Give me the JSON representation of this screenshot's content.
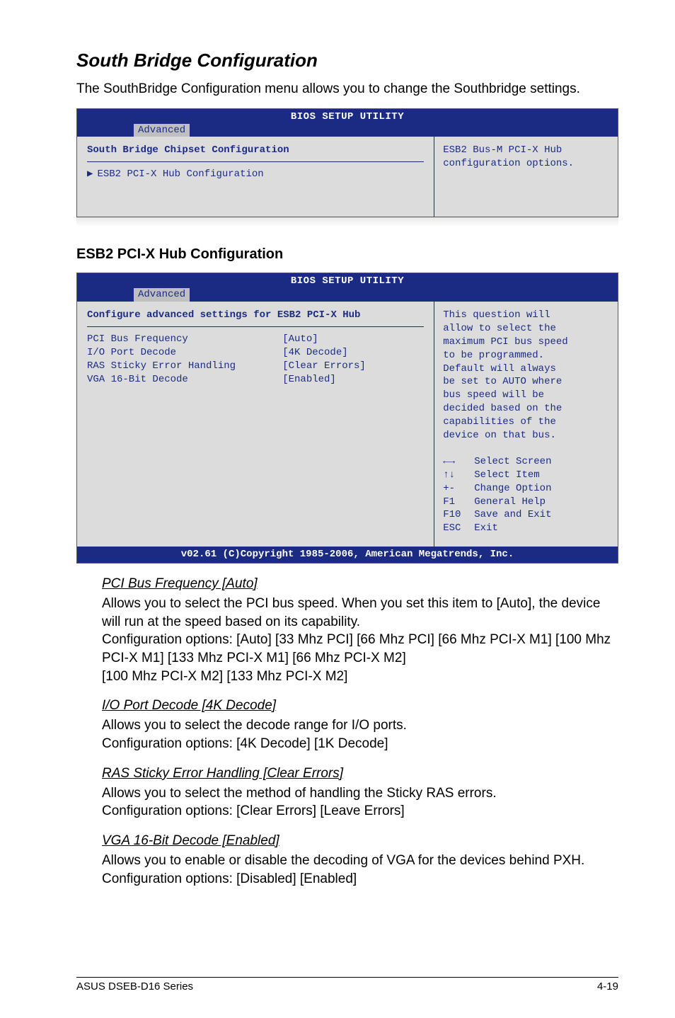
{
  "section_title": "South Bridge Configuration",
  "intro": "The SouthBridge Configuration menu allows you to change the Southbridge settings.",
  "bios1": {
    "header_title": "BIOS SETUP UTILITY",
    "tab": "Advanced",
    "left_heading": "South Bridge Chipset Configuration",
    "left_item": "ESB2 PCI-X Hub Configuration",
    "right_text1": "ESB2 Bus-M PCI-X Hub",
    "right_text2": "configuration options."
  },
  "sub_heading": "ESB2 PCI-X Hub Configuration",
  "bios2": {
    "header_title": "BIOS SETUP UTILITY",
    "tab": "Advanced",
    "left_heading": "Configure advanced settings for ESB2 PCI-X Hub",
    "rows": [
      {
        "label": "PCI Bus Frequency",
        "value": "[Auto]"
      },
      {
        "label": "I/O Port Decode",
        "value": "[4K Decode]"
      },
      {
        "label": "RAS Sticky Error Handling",
        "value": "[Clear Errors]"
      },
      {
        "label": "VGA 16-Bit Decode",
        "value": "[Enabled]"
      }
    ],
    "right_lines": [
      "This question will",
      "allow to select the",
      "maximum PCI bus speed",
      "to be programmed.",
      "Default will always",
      "be set to AUTO where",
      "bus speed will be",
      "decided based on the",
      "capabilities of the",
      "device on that bus."
    ],
    "help": [
      {
        "k": "←→",
        "t": "Select Screen"
      },
      {
        "k": "↑↓",
        "t": "Select Item"
      },
      {
        "k": "+-",
        "t": "Change Option"
      },
      {
        "k": "F1",
        "t": "General Help"
      },
      {
        "k": "F10",
        "t": "Save and Exit"
      },
      {
        "k": "ESC",
        "t": "Exit"
      }
    ],
    "footer": "v02.61 (C)Copyright 1985-2006, American Megatrends, Inc."
  },
  "items": [
    {
      "head": "PCI Bus Frequency [Auto]",
      "p1": "Allows you to select the PCI bus speed. When you set this item to [Auto], the device will run at the speed based on its capability.",
      "p2": "Configuration options: [Auto] [33 Mhz PCI] [66 Mhz PCI] [66 Mhz PCI-X M1] [100 Mhz PCI-X M1] [133 Mhz PCI-X M1] [66 Mhz PCI-X M2]",
      "p3": "[100 Mhz PCI-X M2] [133 Mhz PCI-X M2]"
    },
    {
      "head": "I/O Port Decode [4K Decode]",
      "p1": "Allows you to select the decode range for I/O ports.",
      "p2": "Configuration options: [4K Decode] [1K Decode]"
    },
    {
      "head": "RAS Sticky Error Handling [Clear Errors]",
      "p1": "Allows you to select the method of handling the Sticky RAS errors.",
      "p2": "Configuration options: [Clear Errors] [Leave Errors]"
    },
    {
      "head": "VGA 16-Bit Decode [Enabled]",
      "p1": "Allows you to enable or disable the decoding of VGA for the devices behind PXH. Configuration options: [Disabled] [Enabled]"
    }
  ],
  "footer_left": "ASUS DSEB-D16 Series",
  "footer_right": "4-19"
}
